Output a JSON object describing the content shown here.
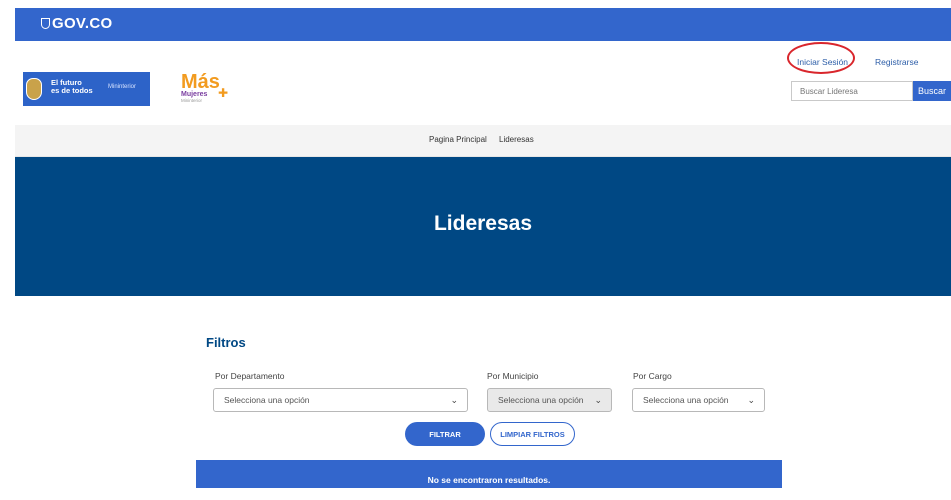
{
  "gov_bar": {
    "brand": "GOV.CO",
    "color": "#3366cc"
  },
  "header": {
    "ministry_logo": {
      "line1": "El futuro",
      "line2": "es de todos",
      "ministry": "Mininterior"
    },
    "program_logo": {
      "main": "Más",
      "sub": "Mujeres",
      "tag": "Mininterior"
    },
    "login_link": "Iniciar Sesión",
    "register_link": "Registrarse",
    "search": {
      "placeholder": "Buscar Lideresa",
      "button": "Buscar"
    }
  },
  "nav": {
    "items": [
      {
        "label": "Pagina Principal"
      },
      {
        "label": "Lideresas"
      }
    ]
  },
  "hero": {
    "title": "Lideresas",
    "color": "#004884"
  },
  "filters": {
    "title": "Filtros",
    "departamento": {
      "label": "Por Departamento",
      "value": "Selecciona una opción"
    },
    "municipio": {
      "label": "Por Municipio",
      "value": "Selecciona una opción",
      "disabled": true
    },
    "cargo": {
      "label": "Por Cargo",
      "value": "Selecciona una opción"
    },
    "filter_button": "FILTRAR",
    "clear_button": "LIMPIAR FILTROS"
  },
  "results": {
    "message": "No se encontraron resultados."
  },
  "annotation": {
    "shape": "circle",
    "color": "#d9262c",
    "target": "login_link"
  }
}
